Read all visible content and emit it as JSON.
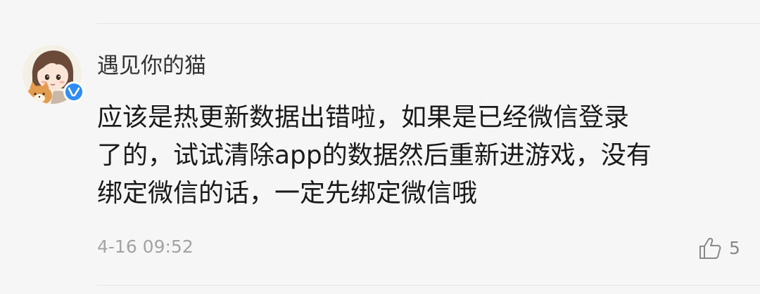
{
  "comment": {
    "username": "遇见你的猫",
    "avatar_icon": "cartoon-girl-with-cat-avatar",
    "verified_icon": "verified-v-badge-icon",
    "verified_color": "#2f8cf5",
    "lines": [
      "应该是热更新数据出错啦，如果是已经微信登录",
      "了的，试试清除app的数据然后重新进游戏，没有",
      "绑定微信的话，一定先绑定微信哦"
    ],
    "timestamp": "4-16 09:52",
    "like_icon": "thumbs-up-icon",
    "like_count": "5"
  }
}
